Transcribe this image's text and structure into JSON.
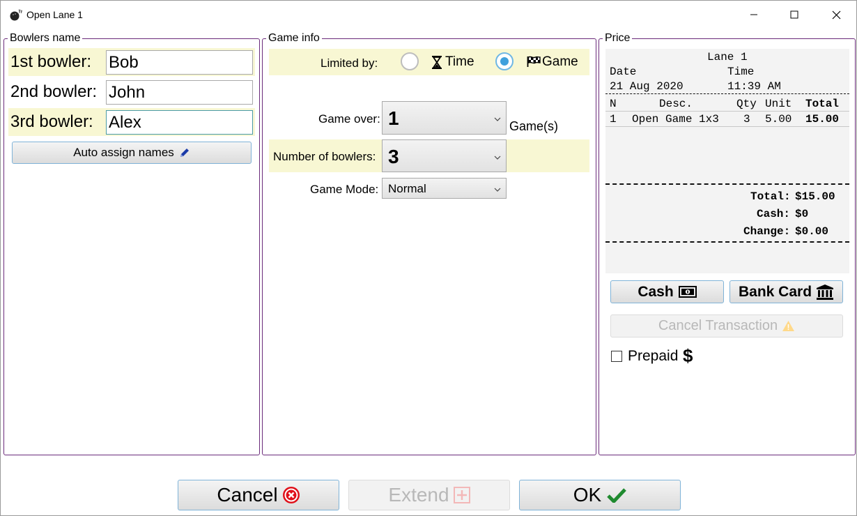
{
  "window": {
    "title": "Open Lane 1"
  },
  "bowlers": {
    "legend": "Bowlers name",
    "rows": [
      {
        "label": "1st bowler:",
        "value": "Bob"
      },
      {
        "label": "2nd bowler:",
        "value": "John"
      },
      {
        "label": "3rd bowler:",
        "value": "Alex"
      }
    ],
    "auto_assign_label": "Auto assign names"
  },
  "game_info": {
    "legend": "Game info",
    "limited_by_label": "Limited by:",
    "option_time": "Time",
    "option_game": "Game",
    "selected_option": "Game",
    "game_over_label": "Game over:",
    "game_over_value": "1",
    "games_suffix": "Game(s)",
    "num_bowlers_label": "Number of bowlers:",
    "num_bowlers_value": "3",
    "game_mode_label": "Game Mode:",
    "game_mode_value": "Normal"
  },
  "price": {
    "legend": "Price",
    "receipt": {
      "lane": "Lane 1",
      "date_label": "Date",
      "time_label": "Time",
      "date": "21 Aug 2020",
      "time": "11:39 AM",
      "columns": {
        "n": "N",
        "desc": "Desc.",
        "qty": "Qty",
        "unit": "Unit",
        "total": "Total"
      },
      "items": [
        {
          "n": "1",
          "desc": "Open Game 1x3",
          "qty": "3",
          "unit": "5.00",
          "total": "15.00"
        }
      ],
      "total_label": "Total:",
      "total_value": "$15.00",
      "cash_label": "Cash:",
      "cash_value": "$0",
      "change_label": "Change:",
      "change_value": "$0.00"
    },
    "cash_button": "Cash",
    "bank_card_button": "Bank Card",
    "cancel_transaction_button": "Cancel Transaction",
    "prepaid_label": "Prepaid",
    "prepaid_checked": false
  },
  "footer": {
    "cancel": "Cancel",
    "extend": "Extend",
    "ok": "OK"
  },
  "colors": {
    "highlight": "#f8f7d3",
    "group_border": "#6a2a7a",
    "button_border": "#7fb3d8",
    "radio_checked": "#3fa0dc",
    "ok_check": "#1f8a2f",
    "cancel_icon": "#e0101a"
  }
}
